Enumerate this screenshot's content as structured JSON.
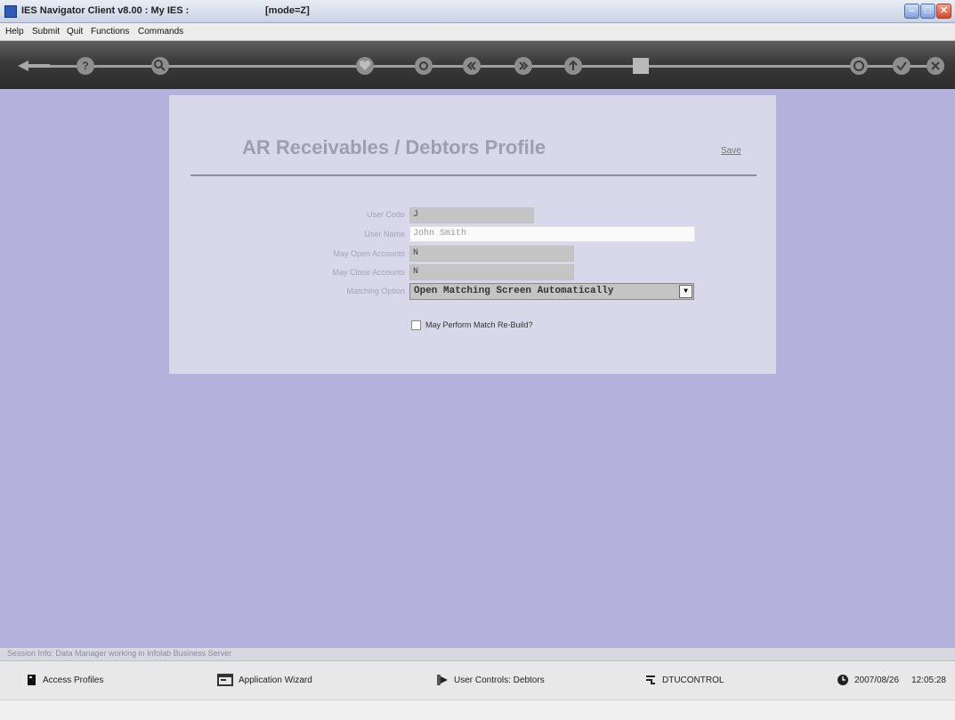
{
  "window": {
    "title": "IES Navigator Client v8.00 : My IES :",
    "mode": "[mode=Z]",
    "minimize": "–",
    "maximize": "□",
    "close": "✕"
  },
  "menu": [
    "Help",
    "Submit",
    "Quit",
    "Functions",
    "Commands"
  ],
  "form": {
    "title": "AR Receivables / Debtors Profile",
    "save_label": "Save",
    "fields": {
      "user_code": {
        "label": "User Code",
        "value": "J"
      },
      "user_name": {
        "label": "User Name",
        "value": "John Smith"
      },
      "may_open": {
        "label": "May Open Accounts",
        "value": "N"
      },
      "may_close": {
        "label": "May Close Accounts",
        "value": "N"
      },
      "matching_option": {
        "label": "Matching Option",
        "value": "Open Matching Screen Automatically"
      }
    },
    "checkbox_label": "May Perform Match Re-Build?"
  },
  "status_line": "Session Info: Data Manager working in Infolab Business Server",
  "statusbar": {
    "access_profiles": "Access Profiles",
    "application_wizard": "Application Wizard",
    "user_controls": "User Controls: Debtors",
    "dtucontrol": "DTUCONTROL",
    "date": "2007/08/26",
    "time": "12:05:28"
  }
}
